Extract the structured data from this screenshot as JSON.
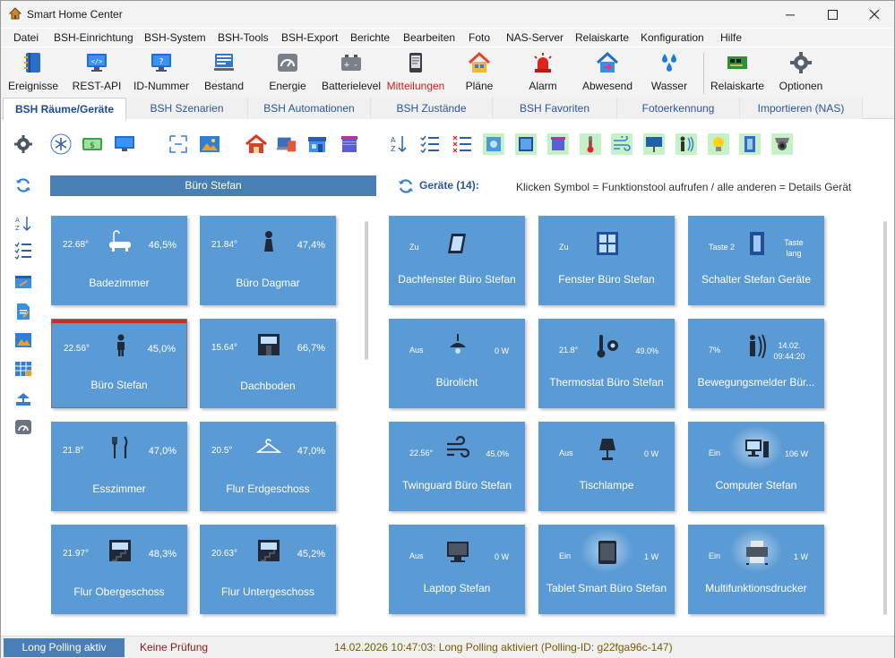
{
  "window": {
    "title": "Smart Home Center"
  },
  "menu": [
    "Datei",
    "BSH-Einrichtung",
    "BSH-System",
    "BSH-Tools",
    "BSH-Export",
    "Berichte",
    "Bearbeiten",
    "Foto",
    "NAS-Server",
    "Relaiskarte",
    "Konfiguration",
    "Hilfe"
  ],
  "toolbar": [
    {
      "label": "Ereignisse",
      "icon": "book-icon"
    },
    {
      "label": "REST-API",
      "icon": "monitor-code-icon"
    },
    {
      "label": "ID-Nummer",
      "icon": "monitor-question-icon"
    },
    {
      "label": "Bestand",
      "icon": "inventory-icon"
    },
    {
      "label": "Energie",
      "icon": "gauge-icon"
    },
    {
      "label": "Batterielevel",
      "icon": "battery-icon"
    },
    {
      "label": "Mitteilungen",
      "icon": "phone-icon",
      "color": "#d4201f"
    },
    {
      "label": "Pläne",
      "icon": "house-plan-icon"
    },
    {
      "label": "Alarm",
      "icon": "siren-icon"
    },
    {
      "label": "Abwesend",
      "icon": "away-house-icon"
    },
    {
      "label": "Wasser",
      "icon": "water-drops-icon"
    },
    {
      "label": "Relaiskarte",
      "icon": "relay-board-icon"
    },
    {
      "label": "Optionen",
      "icon": "gear-icon"
    }
  ],
  "tabs": [
    "BSH Räume/Geräte",
    "BSH Szenarien",
    "BSH Automationen",
    "BSH Zustände",
    "BSH Favoriten",
    "Fotoerkennung",
    "Importieren (NAS)"
  ],
  "rooms_header": "Büro Stefan",
  "rooms": [
    {
      "name": "Badezimmer",
      "temp": "22.68°",
      "hum": "46,5%",
      "icon": "bathtub-icon"
    },
    {
      "name": "Büro Dagmar",
      "temp": "21.84°",
      "hum": "47,4%",
      "icon": "woman-icon"
    },
    {
      "name": "Büro Stefan",
      "temp": "22.56°",
      "hum": "45,0%",
      "icon": "man-icon",
      "selected": true
    },
    {
      "name": "Dachboden",
      "temp": "15.64°",
      "hum": "66,7%",
      "icon": "attic-icon"
    },
    {
      "name": "Esszimmer",
      "temp": "21.8°",
      "hum": "47,0%",
      "icon": "cutlery-icon"
    },
    {
      "name": "Flur Erdgeschoss",
      "temp": "20.5°",
      "hum": "47,0%",
      "icon": "hanger-icon"
    },
    {
      "name": "Flur Obergeschoss",
      "temp": "21.97°",
      "hum": "48,3%",
      "icon": "stairs-icon"
    },
    {
      "name": "Flur Untergeschoss",
      "temp": "20.63°",
      "hum": "45,2%",
      "icon": "stairs-icon"
    }
  ],
  "devices_header": "Geräte (14):",
  "devices_hint": "Klicken Symbol = Funktionstool aufrufen / alle anderen = Details Gerät",
  "devices": [
    {
      "name": "Dachfenster Büro Stefan",
      "left": "Zu",
      "right": "",
      "icon": "roof-window-icon"
    },
    {
      "name": "Fenster Büro Stefan",
      "left": "Zu",
      "right": "",
      "icon": "window-icon"
    },
    {
      "name": "Schalter Stefan Geräte",
      "left": "Taste 2",
      "right": "Taste lang",
      "icon": "switch-icon"
    },
    {
      "name": "Bürolicht",
      "left": "Aus",
      "right": "0 W",
      "icon": "ceiling-lamp-icon"
    },
    {
      "name": "Thermostat Büro Stefan",
      "left": "21.8°",
      "right": "49.0%",
      "icon": "thermostat-icon"
    },
    {
      "name": "Bewegungsmelder Bür...",
      "left": "7%",
      "right": "14.02. 09:44:20",
      "icon": "motion-icon"
    },
    {
      "name": "Twinguard Büro Stefan",
      "left": "22.56°",
      "right": "45.0%",
      "icon": "wind-icon"
    },
    {
      "name": "Tischlampe",
      "left": "Aus",
      "right": "0 W",
      "icon": "table-lamp-icon"
    },
    {
      "name": "Computer Stefan",
      "left": "Ein",
      "right": "106 W",
      "icon": "desktop-icon",
      "glow": true
    },
    {
      "name": "Laptop Stefan",
      "left": "Aus",
      "right": "0 W",
      "icon": "laptop-icon"
    },
    {
      "name": "Tablet Smart Büro Stefan",
      "left": "Ein",
      "right": "1 W",
      "icon": "tablet-icon",
      "glow": true
    },
    {
      "name": "Multifunktionsdrucker",
      "left": "Ein",
      "right": "1 W",
      "icon": "printer-icon",
      "glow": true
    }
  ],
  "status": {
    "polling": "Long Polling aktiv",
    "check": "Keine Prüfung",
    "message": "14.02.2026 10:47:03: Long Polling aktiviert (Polling-ID: g22fga96c-147)"
  }
}
